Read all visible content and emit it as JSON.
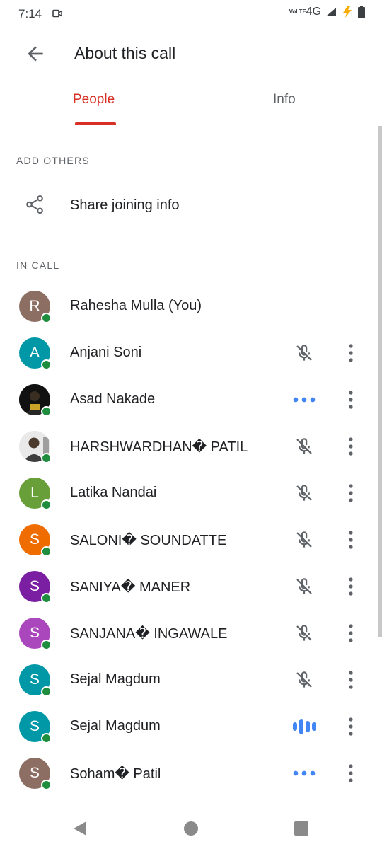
{
  "status_bar": {
    "time": "7:14",
    "network_label": "4G",
    "volte_label": "VoLTE"
  },
  "header": {
    "title": "About this call"
  },
  "tabs": [
    {
      "label": "People",
      "active": true
    },
    {
      "label": "Info",
      "active": false
    }
  ],
  "add_others": {
    "heading": "ADD OTHERS",
    "share_label": "Share joining info"
  },
  "in_call": {
    "heading": "IN CALL"
  },
  "participants": [
    {
      "initial": "R",
      "name": "Rahesha Mulla (You)",
      "color": "#8d6e63",
      "state": "none"
    },
    {
      "initial": "A",
      "name": "Anjani Soni",
      "color": "#0097a7",
      "state": "muted"
    },
    {
      "initial": "",
      "name": "Asad Nakade",
      "color": "#1a1a1a",
      "state": "connecting"
    },
    {
      "initial": "",
      "name": "HARSHWARDHAN� PATIL",
      "color": "#d9d9d9",
      "state": "muted"
    },
    {
      "initial": "L",
      "name": "Latika Nandai",
      "color": "#689f38",
      "state": "muted"
    },
    {
      "initial": "S",
      "name": "SALONI� SOUNDATTE",
      "color": "#ef6c00",
      "state": "muted"
    },
    {
      "initial": "S",
      "name": "SANIYA� MANER",
      "color": "#7b1fa2",
      "state": "muted"
    },
    {
      "initial": "S",
      "name": "SANJANA� INGAWALE",
      "color": "#ab47bc",
      "state": "muted"
    },
    {
      "initial": "S",
      "name": "Sejal Magdum",
      "color": "#0097a7",
      "state": "muted"
    },
    {
      "initial": "S",
      "name": "Sejal Magdum",
      "color": "#0097a7",
      "state": "speaking"
    },
    {
      "initial": "S",
      "name": "Soham� Patil",
      "color": "#8d6e63",
      "state": "connecting"
    }
  ],
  "colors": {
    "accent_red": "#d93025",
    "speaking_blue": "#4285f4",
    "online_green": "#1e8e3e"
  }
}
